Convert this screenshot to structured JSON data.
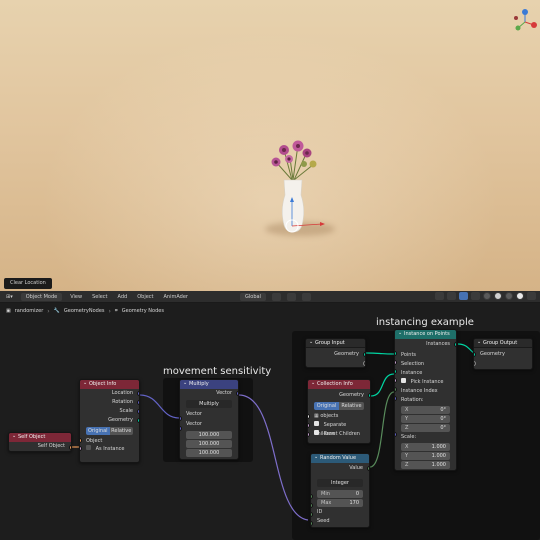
{
  "viewport": {
    "operator_panel": "Clear Location",
    "colors": {
      "floor": "#e3c9a2",
      "vase": "#f4f1ec",
      "flower": "#b24d8e"
    }
  },
  "toolbar": {
    "mode": "Object Mode",
    "menus": [
      "View",
      "Select",
      "Add",
      "Object",
      "AnimAder"
    ],
    "transform_orientation": "Global"
  },
  "breadcrumb": {
    "object": "randomizer",
    "modifier": "GeometryNodes",
    "tree": "Geometry Nodes"
  },
  "frames": {
    "movement": "movement sensitivity",
    "instancing": "instancing example"
  },
  "nodes": {
    "self_object": {
      "title": "Self Object",
      "output": "Self Object"
    },
    "object_info": {
      "title": "Object Info",
      "outputs": [
        "Location",
        "Rotation",
        "Scale",
        "Geometry"
      ],
      "modes": [
        "Original",
        "Relative"
      ],
      "object_input": "Object",
      "as_instance": "As Instance"
    },
    "multiply": {
      "title": "Multiply",
      "output": "Vector",
      "operation": "Multiply",
      "inputs": [
        "Vector",
        "Vector"
      ],
      "values": [
        "100.000",
        "100.000",
        "100.000"
      ]
    },
    "group_input": {
      "title": "Group Input",
      "output": "Geometry"
    },
    "collection_info": {
      "title": "Collection Info",
      "output": "Geometry",
      "modes": [
        "Original",
        "Relative"
      ],
      "collection": "objects",
      "separate_children": "Separate Children",
      "reset_children": "Reset Children"
    },
    "random_value": {
      "title": "Random Value",
      "output": "Value",
      "data_type": "Integer",
      "min_label": "Min",
      "min_value": "0",
      "max_label": "Max",
      "max_value": "170",
      "id_label": "ID",
      "seed_label": "Seed"
    },
    "instance_on_points": {
      "title": "Instance on Points",
      "output": "Instances",
      "inputs": [
        "Points",
        "Selection",
        "Instance"
      ],
      "pick_instance": "Pick Instance",
      "instance_index": "Instance Index",
      "rotation_label": "Rotation:",
      "rotation": [
        {
          "axis": "X",
          "value": "0°"
        },
        {
          "axis": "Y",
          "value": "0°"
        },
        {
          "axis": "Z",
          "value": "0°"
        }
      ],
      "scale_label": "Scale:",
      "scale": [
        {
          "axis": "X",
          "value": "1.000"
        },
        {
          "axis": "Y",
          "value": "1.000"
        },
        {
          "axis": "Z",
          "value": "1.000"
        }
      ]
    },
    "group_output": {
      "title": "Group Output",
      "input": "Geometry"
    }
  }
}
